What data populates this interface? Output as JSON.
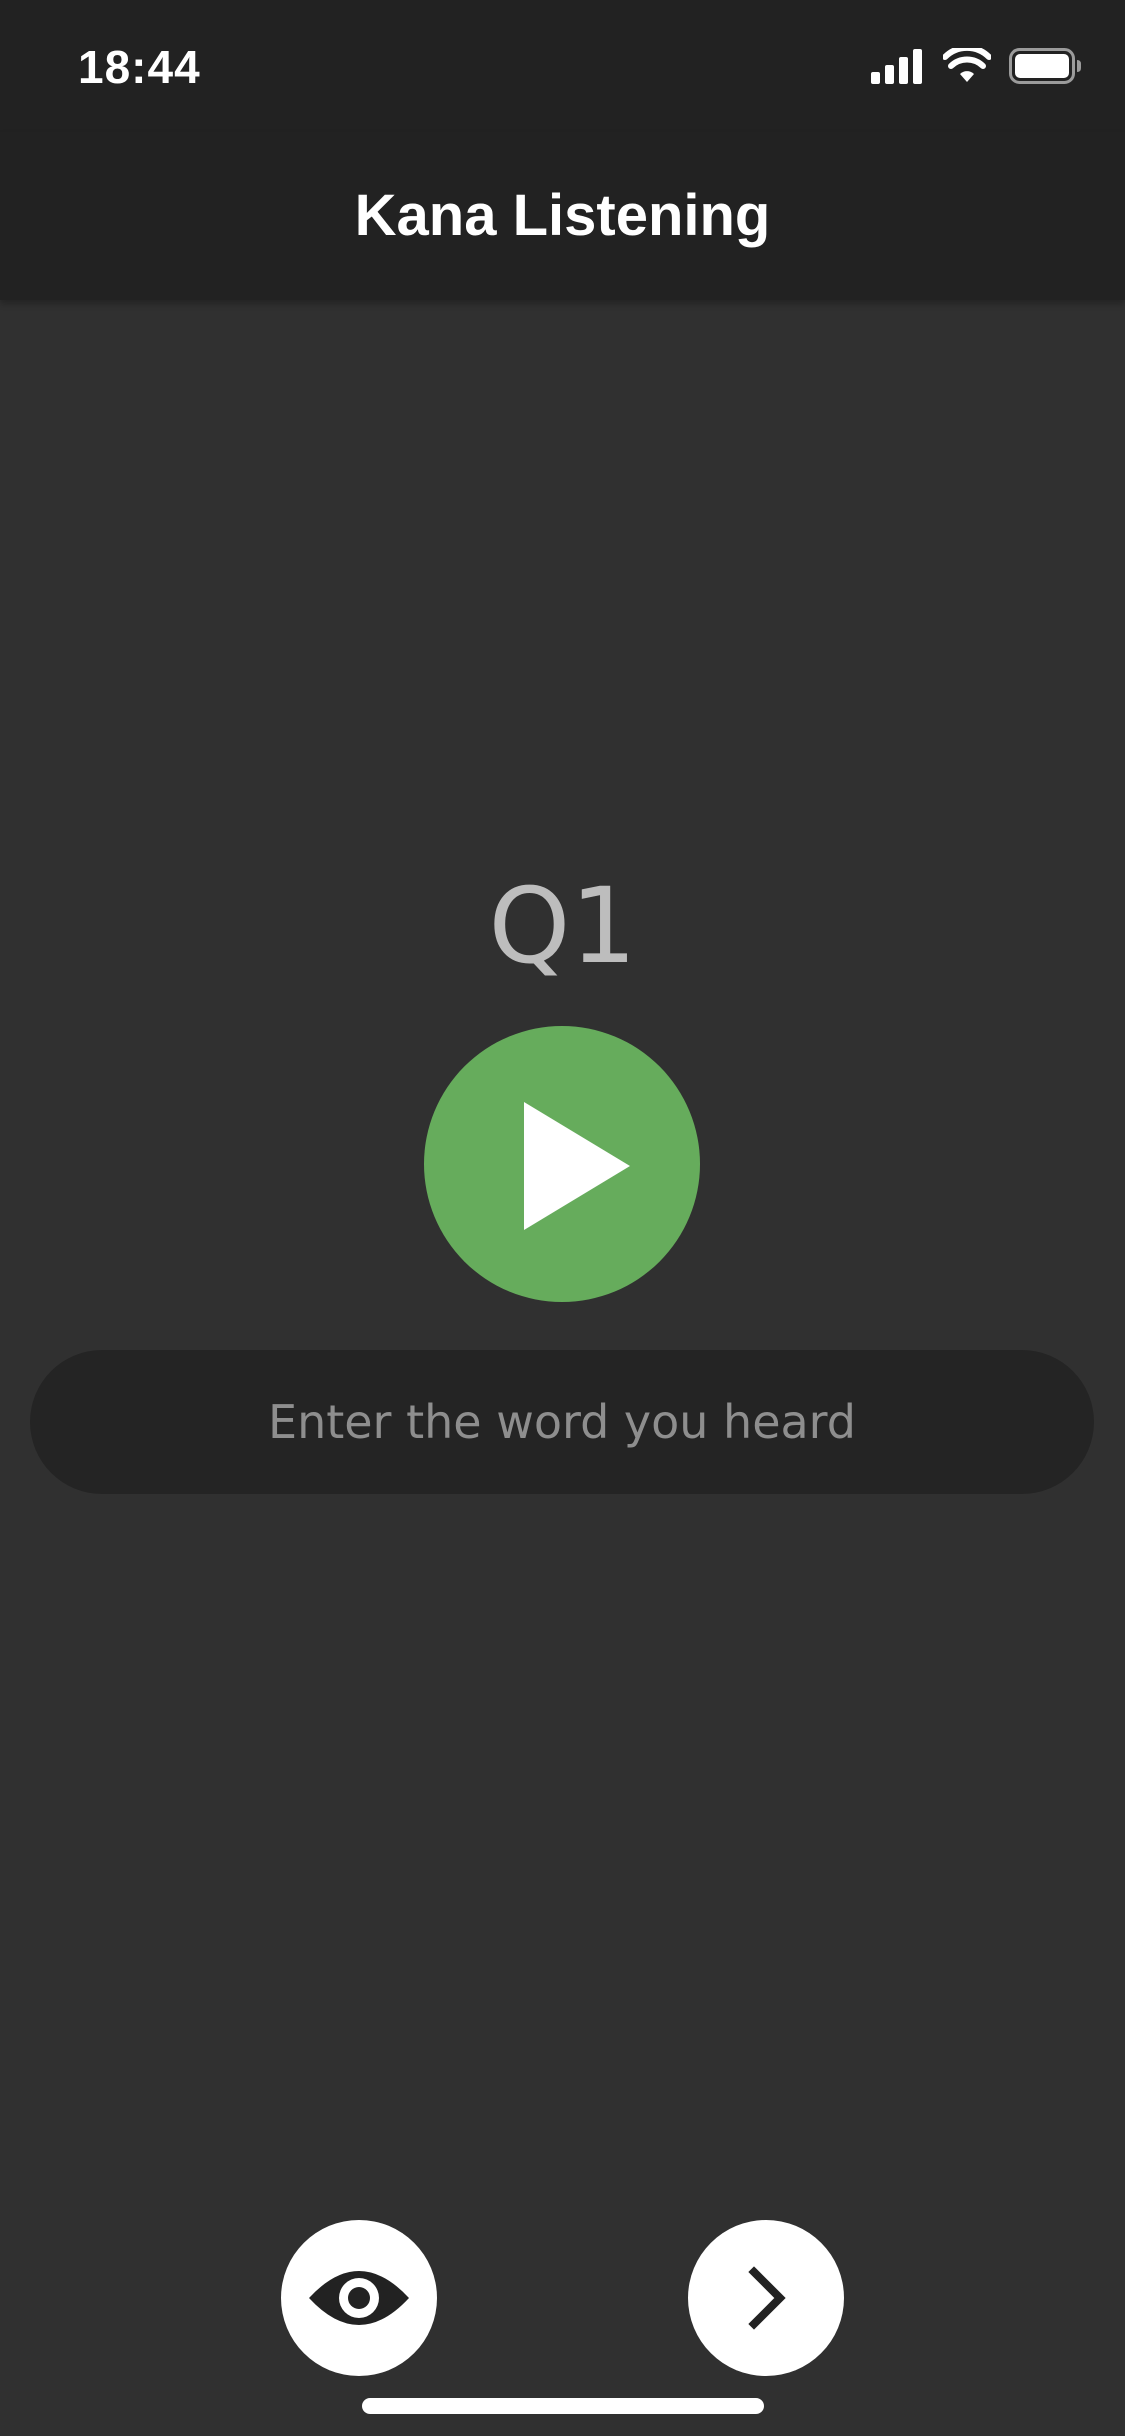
{
  "status_bar": {
    "time": "18:44",
    "icons": [
      "cellular-signal-icon",
      "wifi-icon",
      "battery-icon"
    ]
  },
  "nav": {
    "title": "Kana Listening"
  },
  "quiz": {
    "question_label": "Q1",
    "play_icon": "play-icon",
    "answer_placeholder": "Enter the word you heard",
    "answer_value": ""
  },
  "bottom_bar": {
    "reveal_icon": "eye-icon",
    "next_icon": "chevron-right-icon"
  },
  "colors": {
    "background": "#303030",
    "bar_background": "#222222",
    "accent_green": "#66ac5c",
    "input_background": "#242424",
    "question_text": "#bdbdbd"
  }
}
